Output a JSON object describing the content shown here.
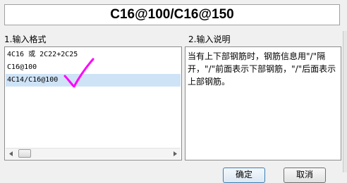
{
  "header": {
    "value": "C16@100/C16@150"
  },
  "input_format": {
    "label": "1.输入格式",
    "items": [
      {
        "text": "4C16 或 2C22+2C25"
      },
      {
        "text": "C16@100"
      },
      {
        "text": "4C14/C16@100"
      }
    ],
    "selected_index": 2
  },
  "description": {
    "label": "2.输入说明",
    "text": "当有上下部钢筋时，钢筋信息用\"/\"隔开，\"/\"前面表示下部钢筋，\"/\"后面表示上部钢筋。"
  },
  "buttons": {
    "ok_label": "确定",
    "cancel_label": "取消"
  },
  "colors": {
    "selection": "#cfe3f6",
    "annotation": "#ff00ff"
  },
  "icons": {
    "scroll_left": "triangle-left-icon",
    "scroll_right": "triangle-right-icon",
    "annotation": "handwritten-checkmark-icon"
  }
}
